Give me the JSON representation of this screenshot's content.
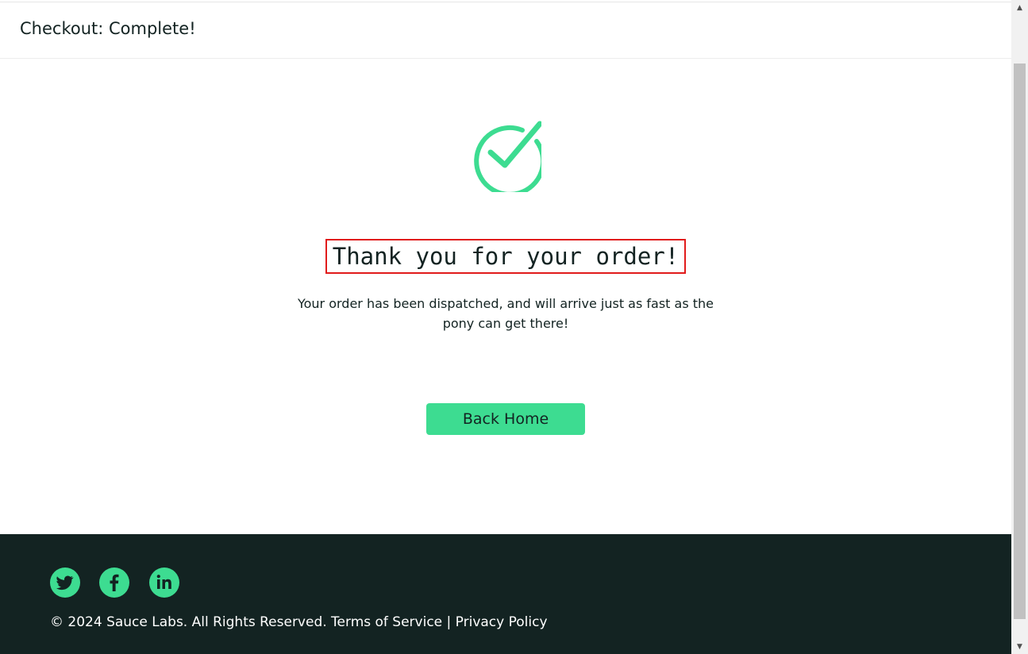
{
  "header": {
    "title": "Checkout: Complete!"
  },
  "main": {
    "check_icon": "checkmark-circle-icon",
    "heading": "Thank you for your order!",
    "message": "Your order has been dispatched, and will arrive just as fast as the pony can get there!",
    "back_button_label": "Back Home"
  },
  "footer": {
    "social": [
      "twitter-icon",
      "facebook-icon",
      "linkedin-icon"
    ],
    "copyright": "© 2024 Sauce Labs. All Rights Reserved. Terms of Service | Privacy Policy"
  },
  "colors": {
    "accent": "#3ddc91",
    "dark": "#132322",
    "highlight_border": "#e11b1b"
  },
  "scrollbar": {
    "up_icon": "scroll-up-arrow-icon",
    "down_icon": "scroll-down-arrow-icon"
  }
}
